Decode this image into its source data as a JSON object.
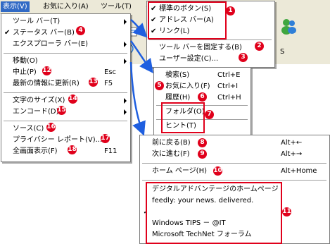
{
  "menubar": {
    "view": "表示(V)",
    "favorites": "お気に入り(A)",
    "tools": "ツール(T)",
    "help": "ヘ"
  },
  "view_menu": {
    "toolbars": "ツール バー(T)",
    "statusbar": "ステータス バー(B)",
    "explorer_bar": "エクスプローラ バー(E)",
    "goto": "移動(O)",
    "stop": "中止(P)",
    "stop_shortcut": "Esc",
    "refresh": "最新の情報に更新(R)",
    "refresh_shortcut": "F5",
    "text_size": "文字のサイズ(X)",
    "encoding": "エンコード(D)",
    "source": "ソース(C)",
    "privacy": "プライバシー レポート(V)...",
    "fullscreen": "全画面表示(F)",
    "fullscreen_shortcut": "F11"
  },
  "toolbars_menu": {
    "standard_buttons": "標準のボタン(S)",
    "address_bar": "アドレス バー(A)",
    "links": "リンク(L)",
    "lock": "ツール バーを固定する(B)",
    "customize": "ユーザー設定(C)..."
  },
  "explorer_menu": {
    "search": "検索(S)",
    "search_shortcut": "Ctrl+E",
    "favorites": "お気に入り(F)",
    "favorites_shortcut": "Ctrl+I",
    "history": "履歴(H)",
    "history_shortcut": "Ctrl+H",
    "folders": "フォルダ(O)",
    "tips": "ヒント(T)"
  },
  "goto_menu": {
    "back": "前に戻る(B)",
    "back_shortcut": "Alt+←",
    "forward": "次に進む(F)",
    "forward_shortcut": "Alt+→",
    "home": "ホーム ページ(H)",
    "home_shortcut": "Alt+Home",
    "recent": [
      "デジタルアドバンテージのホームページ",
      "feedly: your news. delivered.",
      "",
      "Windows TIPS － @IT",
      "Microsoft TechNet フォーラム"
    ]
  },
  "badges": [
    "1",
    "2",
    "3",
    "4",
    "5",
    "6",
    "7",
    "8",
    "9",
    "10",
    "11",
    "12",
    "13",
    "14",
    "15",
    "16",
    "17",
    "18"
  ],
  "toolbar_fragment": "S",
  "colors": {
    "annotation": "#e0001b",
    "highlight": "#316ac5",
    "arrow": "#1f5fe0"
  }
}
